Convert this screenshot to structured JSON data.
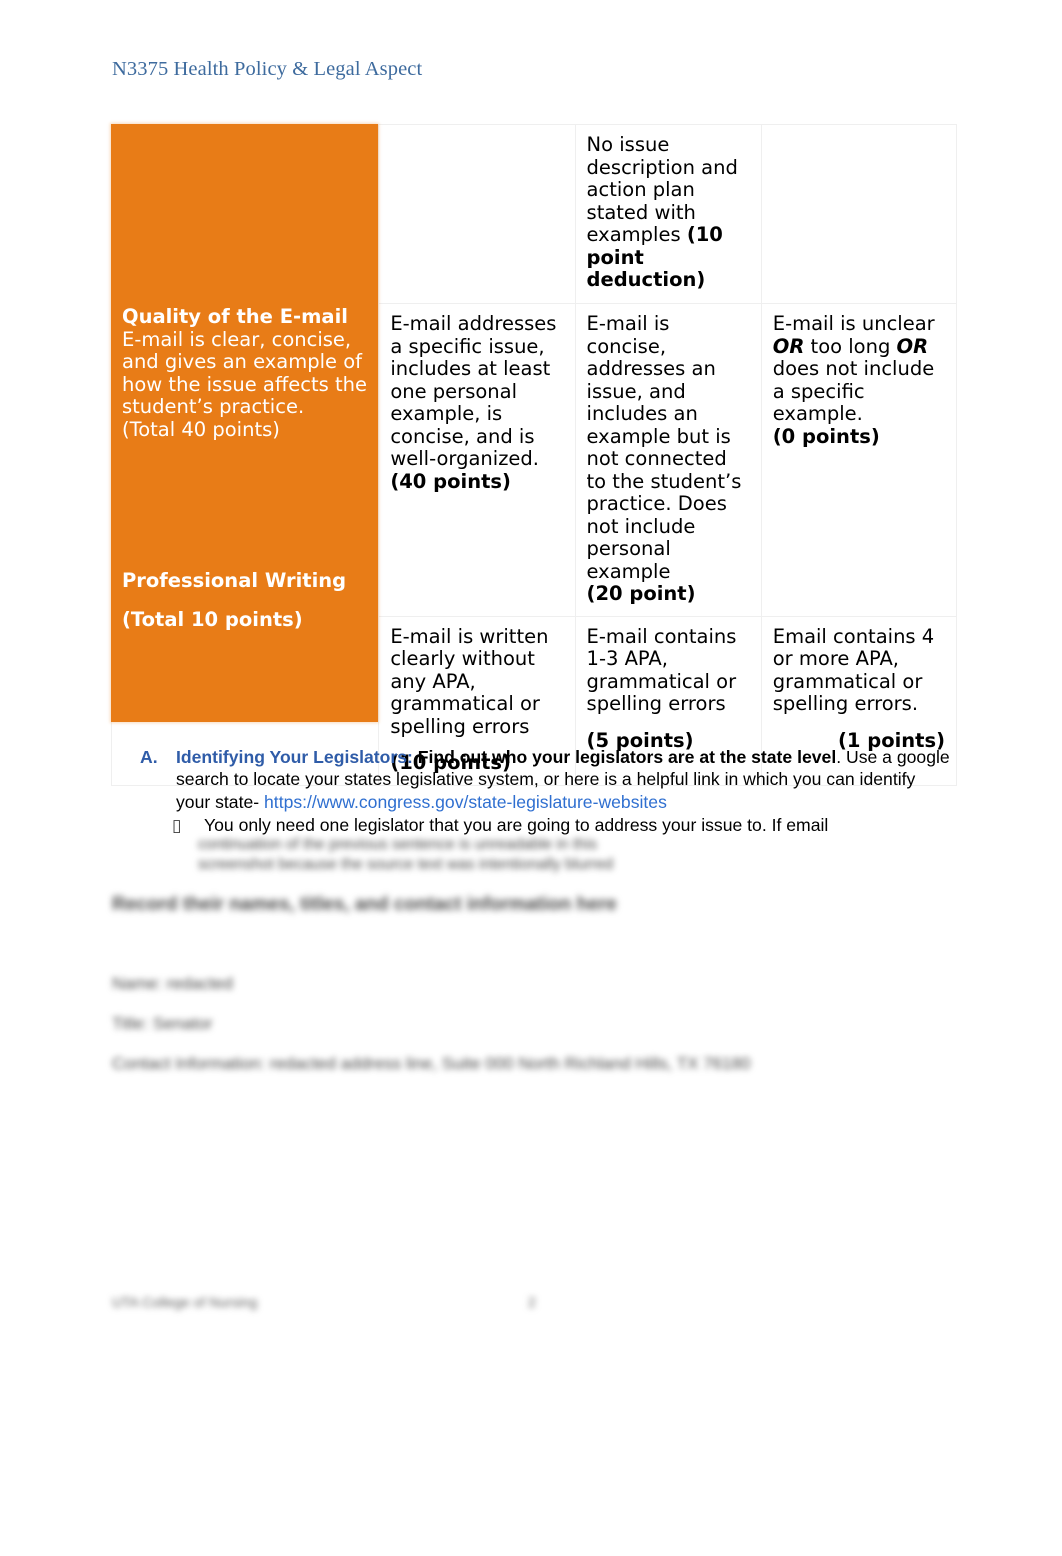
{
  "header": {
    "running_title": "N3375 Health Policy & Legal Aspect"
  },
  "colors": {
    "criteria_band_orange": "#e87c17",
    "header_blue": "#3e6b9e",
    "outline_blue": "#2f5ca8",
    "hyperlink_blue": "#2f6fd0",
    "table_border_gray": "#efefef"
  },
  "rubric_table": {
    "rows": [
      {
        "criteria": "",
        "col_b": "",
        "col_c_text": "No issue description and action plan stated with examples ",
        "col_c_points": "(10 point deduction)",
        "col_d": ""
      },
      {
        "criteria_title": "Quality of the E-mail",
        "criteria_body": "E-mail is clear, concise, and gives an example of how the issue affects the student’s practice.",
        "criteria_total": "(Total 40 points)",
        "col_b_text": "E-mail addresses a specific issue, includes at least one personal example, is concise, and is well-organized.",
        "col_b_points": "(40 points)",
        "col_c_text": "E-mail is concise, addresses an issue, and includes an example but is not connected to the student’s practice. Does not include personal example",
        "col_c_points": "(20 point)",
        "col_d_text_1": "E-mail is unclear ",
        "col_d_or_1": "OR",
        "col_d_text_2": " too long ",
        "col_d_or_2": "OR",
        "col_d_text_3": " does not include a specific example.",
        "col_d_points": "(0 points)"
      },
      {
        "criteria_title": "Professional Writing",
        "criteria_total": "(Total 10 points)",
        "col_b_text": "E-mail is written clearly without any APA, grammatical or spelling errors",
        "col_b_points": "(10 points)",
        "col_c_text": "E-mail contains 1-3 APA, grammatical or spelling errors",
        "col_c_points": "(5 points)",
        "col_d_text": "Email contains 4 or more APA, grammatical or spelling errors.",
        "col_d_points": "(1  points)"
      }
    ]
  },
  "outline": {
    "item_a": {
      "marker": "A.",
      "lead": "Identifying Your Legislators:",
      "bold_clause": "Find out who your legislators are at the state level",
      "body_1": ". Use a google search to locate your states legislative system, or here is a helpful link in which you can identify your state- ",
      "link_text": "https://www.congress.gov/state-legislature-websites"
    },
    "sub_item": {
      "bullet_glyph": "▯",
      "text": "You only need one legislator that you are going to address your issue to.  If email"
    }
  },
  "redacted": {
    "note": "blurred/illegible text in source screenshot",
    "tail_line_1": "continuation of the previous sentence is unreadable in this",
    "tail_line_2": "screenshot because the source text was intentionally blurred",
    "heading_line": "Record their names, titles, and contact information here",
    "name_line": "Name: redacted",
    "title_line": "Title: Senator",
    "contact_line": "Contact Information: redacted address line, Suite 000 North Richland Hills, TX 76180",
    "footer_line": "UTA College of Nursing",
    "page_number": "2"
  }
}
